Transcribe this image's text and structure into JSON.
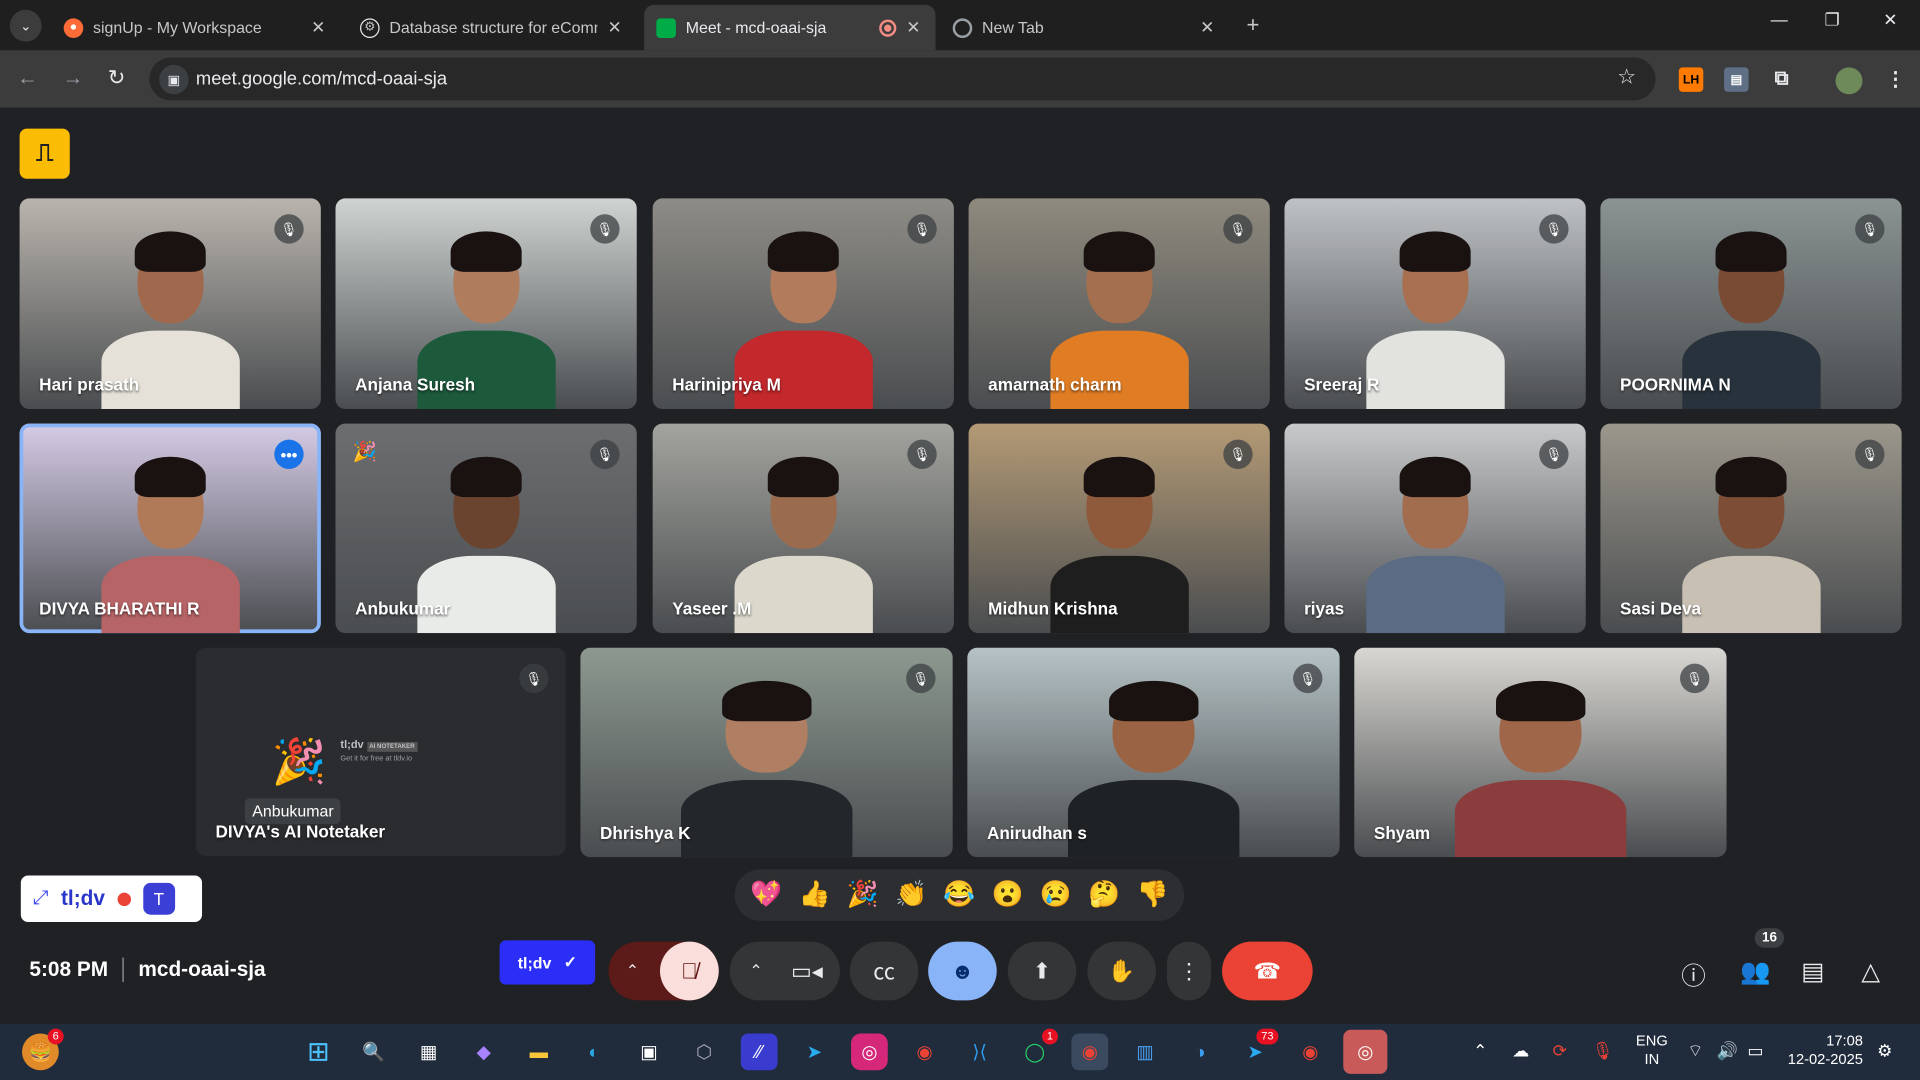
{
  "browser": {
    "tabs": [
      {
        "title": "signUp - My Workspace",
        "favicon": "postman-icon",
        "color": "#ff6c37"
      },
      {
        "title": "Database structure for eComme",
        "favicon": "chatgpt-icon",
        "color": "#e8eaed"
      },
      {
        "title": "Meet - mcd-oaai-sja",
        "favicon": "meet-icon",
        "color": "#00ac47",
        "active": true
      },
      {
        "title": "New Tab",
        "favicon": "chrome-icon",
        "color": "#9aa0a6"
      }
    ],
    "url": "meet.google.com/mcd-oaai-sja"
  },
  "meet": {
    "participants": [
      {
        "name": "Hari prasath",
        "muted": true,
        "bg": "#b9b4ad",
        "skin": "#a0694d",
        "shirt": "#e5e1d8"
      },
      {
        "name": "Anjana Suresh",
        "muted": true,
        "bg": "#cfd4d2",
        "skin": "#b07c5e",
        "shirt": "#1d5a3c"
      },
      {
        "name": "Harinipriya M",
        "muted": true,
        "bg": "#8e8c86",
        "skin": "#b27b5c",
        "shirt": "#c2282c"
      },
      {
        "name": "amarnath charm",
        "muted": true,
        "bg": "#8f8a7e",
        "skin": "#a36f4e",
        "shirt": "#e07d24"
      },
      {
        "name": "Sreeraj R",
        "muted": true,
        "bg": "#bfc2c5",
        "skin": "#a87050",
        "shirt": "#e2e2df"
      },
      {
        "name": "POORNIMA N",
        "muted": true,
        "bg": "#8b9393",
        "skin": "#7a4b34",
        "shirt": "#28323c"
      },
      {
        "name": "DIVYA BHARATHI R",
        "muted": false,
        "speaking": true,
        "bg": "#d5cbe6",
        "skin": "#b07a58",
        "shirt": "#b76466"
      },
      {
        "name": "Anbukumar",
        "muted": true,
        "bg": "#6c6e70",
        "skin": "#6b4430",
        "shirt": "#e9ebe8",
        "reaction": "🎉"
      },
      {
        "name": "Yaseer .M",
        "muted": true,
        "bg": "#a3a49e",
        "skin": "#9a6b4d",
        "shirt": "#dcd8cc"
      },
      {
        "name": "Midhun Krishna",
        "muted": true,
        "bg": "#b49a75",
        "skin": "#8f5a3b",
        "shirt": "#1e1e1e"
      },
      {
        "name": "riyas",
        "muted": true,
        "bg": "#c8c9cb",
        "skin": "#a26c4f",
        "shirt": "#5c6b84"
      },
      {
        "name": "Sasi Deva",
        "muted": true,
        "bg": "#9c978c",
        "skin": "#7d4d35",
        "shirt": "#c9c0b4"
      },
      {
        "name": "Dhrishya K",
        "muted": true,
        "bg": "#8d9990",
        "skin": "#b07e62",
        "shirt": "#23262b"
      },
      {
        "name": "Anirudhan s",
        "muted": true,
        "bg": "#b6c3c6",
        "skin": "#9a6444",
        "shirt": "#1e2224"
      },
      {
        "name": "Shyam",
        "muted": true,
        "bg": "#d9d7d2",
        "skin": "#9f6649",
        "shirt": "#8a3d3c"
      }
    ],
    "notetaker": {
      "name": "DIVYA's AI Notetaker",
      "reaction_by": "Anbukumar",
      "reaction": "🎉",
      "brand": "tl;dv",
      "brand_sub": "AI NOTETAKER",
      "promo": "Get it for free at tldv.io"
    },
    "reactions": [
      "💖",
      "👍",
      "🎉",
      "👏",
      "😂",
      "😮",
      "😢",
      "🤔",
      "👎"
    ],
    "tldv_label": "tl;dv",
    "time": "5:08 PM",
    "code": "mcd-oaai-sja",
    "participant_count": "16",
    "accent": "#ea4335",
    "active_btn": "#8ab4f8"
  },
  "taskbar": {
    "badges": {
      "start": "6",
      "whatsapp": "1",
      "telegram": "73"
    },
    "lang": "ENG",
    "region": "IN",
    "time": "17:08",
    "date": "12-02-2025"
  }
}
